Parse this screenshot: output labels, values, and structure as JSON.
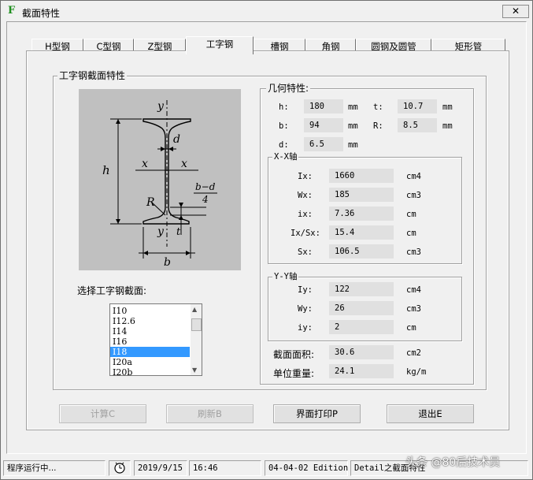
{
  "window": {
    "title": "截面特性",
    "app_icon_glyph": "F",
    "close_glyph": "✕"
  },
  "tabs": [
    {
      "label": "H型钢",
      "active": false
    },
    {
      "label": "C型钢",
      "active": false
    },
    {
      "label": "Z型钢",
      "active": false
    },
    {
      "label": "工字钢",
      "active": true
    },
    {
      "label": "槽钢",
      "active": false
    },
    {
      "label": "角钢",
      "active": false
    },
    {
      "label": "圆钢及圆管",
      "active": false
    },
    {
      "label": "矩形管",
      "active": false
    }
  ],
  "section_group": {
    "label": "工字钢截面特性",
    "select_label": "选择工字钢截面:",
    "diagram_labels": {
      "y_top": "y",
      "y_bottom": "y",
      "x_left": "x",
      "x_right": "x",
      "h": "h",
      "d": "d",
      "R": "R",
      "t": "t",
      "b": "b",
      "frac_num": "b−d",
      "frac_den": "4"
    },
    "list_items": [
      "I10",
      "I12.6",
      "I14",
      "I16",
      "I18",
      "I20a",
      "I20b"
    ],
    "selected_item": "I18"
  },
  "geometry": {
    "label": "几何特性:",
    "h": {
      "label": "h:",
      "value": "180",
      "unit": "mm"
    },
    "t": {
      "label": "t:",
      "value": "10.7",
      "unit": "mm"
    },
    "b": {
      "label": "b:",
      "value": "94",
      "unit": "mm"
    },
    "R": {
      "label": "R:",
      "value": "8.5",
      "unit": "mm"
    },
    "d": {
      "label": "d:",
      "value": "6.5",
      "unit": "mm"
    }
  },
  "xx_axis": {
    "label": "X-X轴",
    "rows": [
      {
        "label": "Ix:",
        "value": "1660",
        "unit": "cm4"
      },
      {
        "label": "Wx:",
        "value": "185",
        "unit": "cm3"
      },
      {
        "label": "ix:",
        "value": "7.36",
        "unit": "cm"
      },
      {
        "label": "Ix/Sx:",
        "value": "15.4",
        "unit": "cm"
      },
      {
        "label": "Sx:",
        "value": "106.5",
        "unit": "cm3"
      }
    ]
  },
  "yy_axis": {
    "label": "Y-Y轴",
    "rows": [
      {
        "label": "Iy:",
        "value": "122",
        "unit": "cm4"
      },
      {
        "label": "Wy:",
        "value": "26",
        "unit": "cm3"
      },
      {
        "label": "iy:",
        "value": "2",
        "unit": "cm"
      }
    ]
  },
  "area": {
    "label": "截面面积:",
    "value": "30.6",
    "unit": "cm2"
  },
  "weight": {
    "label": "单位重量:",
    "value": "24.1",
    "unit": "kg/m"
  },
  "buttons": {
    "calc": "计算C",
    "refresh": "刷新B",
    "print": "界面打印P",
    "exit": "退出E"
  },
  "statusbar": {
    "status": "程序运行中...",
    "date": "2019/9/15",
    "time": "16:46",
    "edition": "04-04-02 Edition",
    "detail": "Detail之截面特性"
  },
  "watermark": "头条 @80后技术员"
}
